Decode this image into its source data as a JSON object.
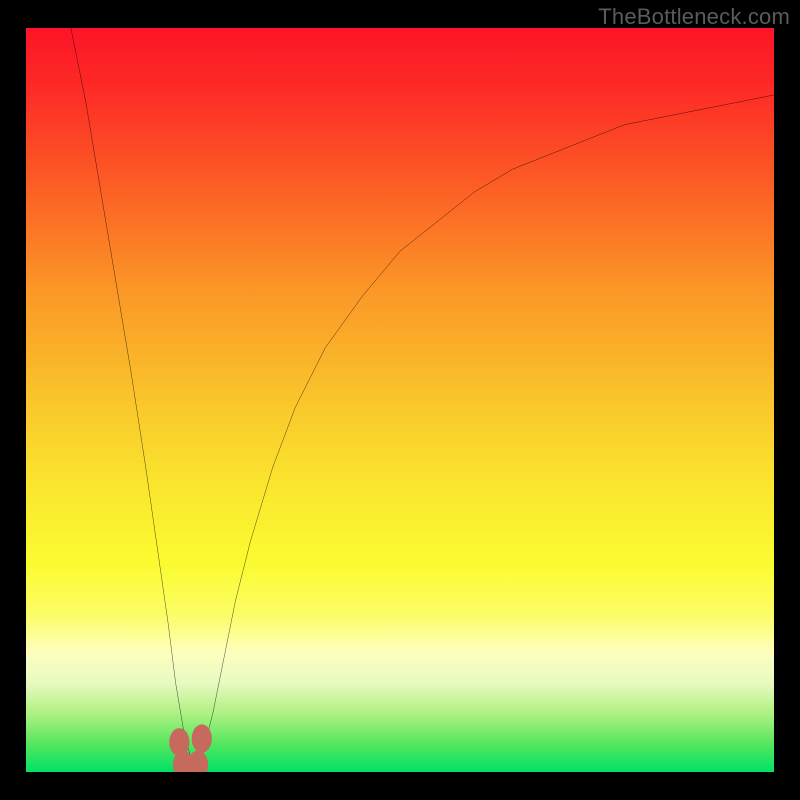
{
  "watermark": "TheBottleneck.com",
  "colors": {
    "frame": "#000000",
    "curve": "#000000",
    "marker_fill": "#c66a5e",
    "gradient_stops": [
      {
        "offset": 0.0,
        "color": "#fd1427"
      },
      {
        "offset": 0.08,
        "color": "#fd2a26"
      },
      {
        "offset": 0.2,
        "color": "#fc5925"
      },
      {
        "offset": 0.35,
        "color": "#fb9627"
      },
      {
        "offset": 0.5,
        "color": "#fac52b"
      },
      {
        "offset": 0.62,
        "color": "#fae72e"
      },
      {
        "offset": 0.72,
        "color": "#fbfb30"
      },
      {
        "offset": 0.79,
        "color": "#fcfd68"
      },
      {
        "offset": 0.84,
        "color": "#fefebf"
      },
      {
        "offset": 0.88,
        "color": "#e7fac0"
      },
      {
        "offset": 0.92,
        "color": "#b1f184"
      },
      {
        "offset": 0.96,
        "color": "#5ae75f"
      },
      {
        "offset": 1.0,
        "color": "#00e165"
      }
    ]
  },
  "chart_data": {
    "type": "line",
    "title": "",
    "xlabel": "",
    "ylabel": "",
    "xlim": [
      0,
      100
    ],
    "ylim": [
      0,
      100
    ],
    "grid": false,
    "note": "Axes are unlabeled in the image; x/y ranges normalized to 0–100. Curve dips to 0 near x≈22 and rises toward ~90 at the right edge. Values read from pixel positions.",
    "series": [
      {
        "name": "curve",
        "x": [
          6,
          8,
          10,
          12,
          14,
          16,
          18,
          19,
          20,
          21,
          22,
          23,
          24,
          25,
          26,
          28,
          30,
          33,
          36,
          40,
          45,
          50,
          55,
          60,
          65,
          70,
          75,
          80,
          85,
          90,
          95,
          100
        ],
        "y": [
          100,
          90,
          78,
          66,
          54,
          41,
          27,
          20,
          12,
          6,
          2,
          2,
          4,
          8,
          13,
          23,
          31,
          41,
          49,
          57,
          64,
          70,
          74,
          78,
          81,
          83,
          85,
          87,
          88,
          89,
          90,
          91
        ]
      }
    ],
    "markers": [
      {
        "x": 20.5,
        "y": 4.0
      },
      {
        "x": 23.5,
        "y": 4.5
      },
      {
        "x": 21.0,
        "y": 1.0
      },
      {
        "x": 23.0,
        "y": 1.0
      },
      {
        "x": 22.0,
        "y": 0.5
      }
    ]
  }
}
